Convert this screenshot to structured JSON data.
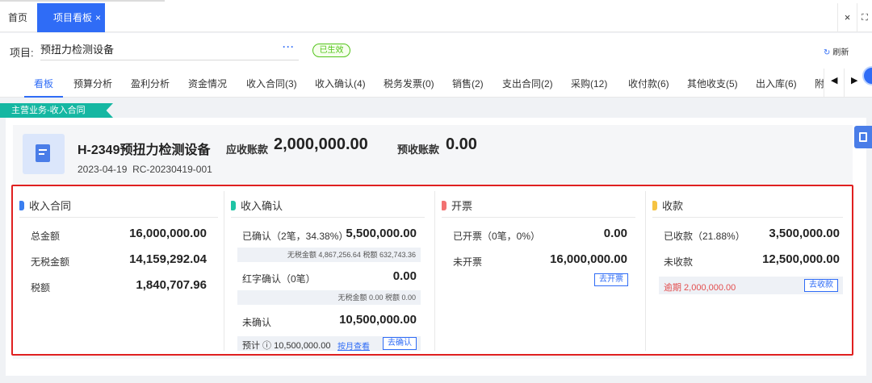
{
  "topbar": {
    "home_tab": "首页",
    "active_tab": "项目看板",
    "close_glyph": "×",
    "window_close": "×",
    "fullscreen": "⛶"
  },
  "project": {
    "label": "项目:",
    "value": "预扭力检测设备",
    "more": "···",
    "status": "已生效",
    "refresh": "刷新"
  },
  "nav": {
    "tabs": [
      "看板",
      "预算分析",
      "盈利分析",
      "资金情况",
      "收入合同(3)",
      "收入确认(4)",
      "税务发票(0)",
      "销售(2)",
      "支出合同(2)",
      "采购(12)",
      "收付款(6)",
      "其他收支(5)",
      "出入库(6)",
      "附"
    ],
    "active_index": 0
  },
  "section": {
    "ribbon": "主营业务-收入合同"
  },
  "contract": {
    "title": "H-2349预扭力检测设备",
    "date": "2023-04-19",
    "code": "RC-20230419-001",
    "receivable_label": "应收账款",
    "receivable_value": "2,000,000.00",
    "advance_label": "预收账款",
    "advance_value": "0.00"
  },
  "panels": {
    "contract": {
      "title": "收入合同",
      "color": "#3a7ef0",
      "rows": [
        {
          "label": "总金额",
          "value": "16,000,000.00"
        },
        {
          "label": "无税金额",
          "value": "14,159,292.04"
        },
        {
          "label": "税额",
          "value": "1,840,707.96"
        }
      ]
    },
    "confirm": {
      "title": "收入确认",
      "color": "#1fc4a5",
      "confirmed_label": "已确认（2笔，34.38%）",
      "confirmed_value": "5,500,000.00",
      "confirmed_sub": "无税金额 4,867,256.64 税额 632,743.36",
      "red_label": "红字确认（0笔）",
      "red_value": "0.00",
      "red_sub": "无税金额 0.00 税额 0.00",
      "pending_label": "未确认",
      "pending_value": "10,500,000.00",
      "forecast_label": "预计 ⓘ 10,500,000.00",
      "monthly_link": "按月查看",
      "confirm_button": "去确认"
    },
    "invoice": {
      "title": "开票",
      "color": "#f27272",
      "issued_label": "已开票（0笔，0%）",
      "issued_value": "0.00",
      "unissued_label": "未开票",
      "unissued_value": "16,000,000.00",
      "button": "去开票"
    },
    "receipt": {
      "title": "收款",
      "color": "#f5c342",
      "received_label": "已收款（21.88%）",
      "received_value": "3,500,000.00",
      "unreceived_label": "未收款",
      "unreceived_value": "12,500,000.00",
      "overdue": "逾期 2,000,000.00",
      "button": "去收款"
    }
  }
}
